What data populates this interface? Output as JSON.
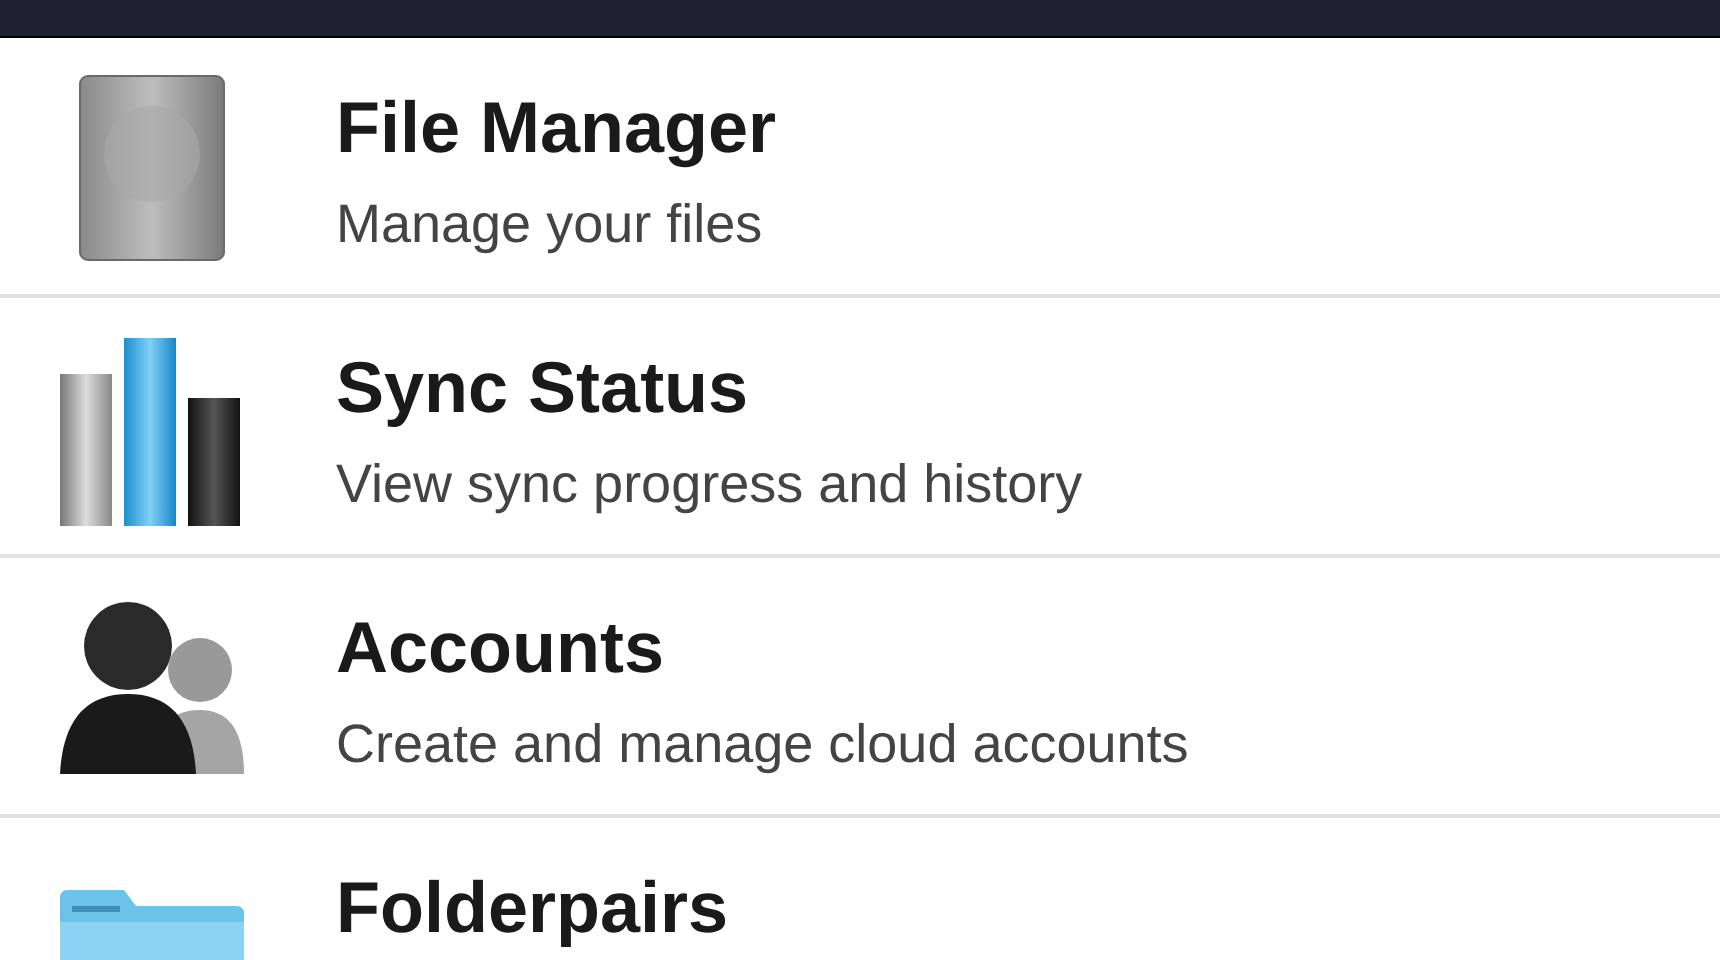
{
  "items": [
    {
      "kind": "drive",
      "title": "File Manager",
      "subtitle": "Manage your files"
    },
    {
      "kind": "chart",
      "title": "Sync Status",
      "subtitle": "View sync progress and history"
    },
    {
      "kind": "people",
      "title": "Accounts",
      "subtitle": "Create and manage cloud accounts"
    },
    {
      "kind": "folder",
      "title": "Folderpairs"
    }
  ]
}
